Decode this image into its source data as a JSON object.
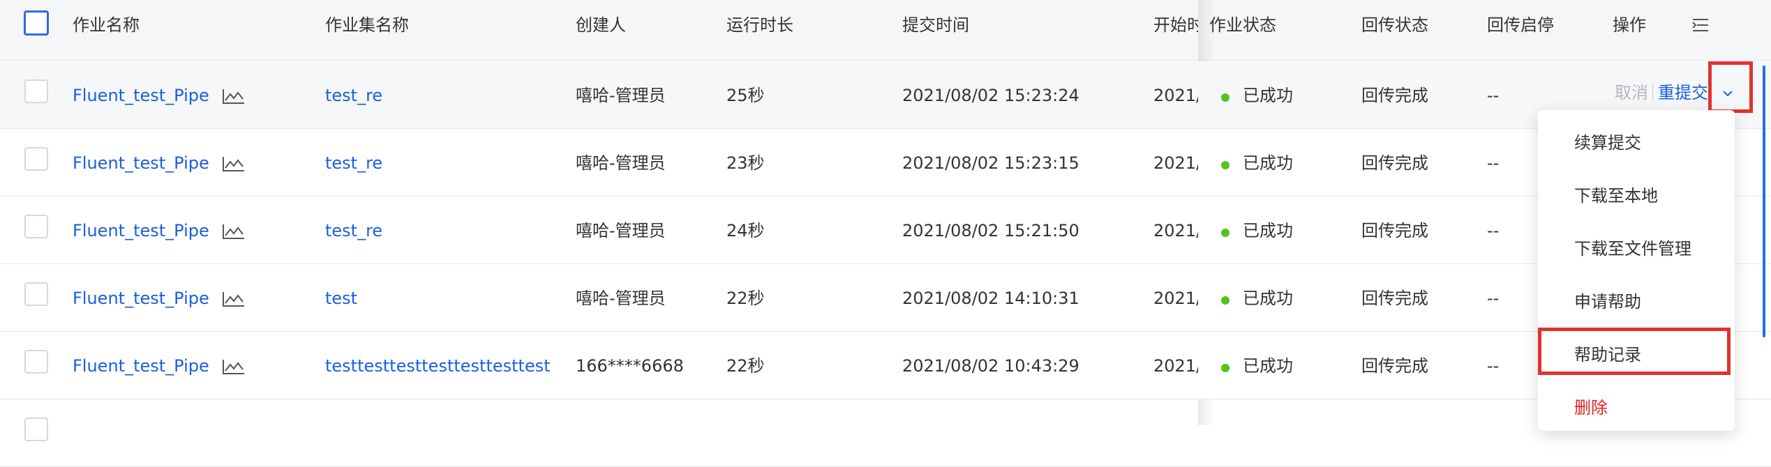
{
  "columns": {
    "job_name": "作业名称",
    "jobset_name": "作业集名称",
    "creator": "创建人",
    "duration": "运行时长",
    "submit_time": "提交时间",
    "start_time": "开始时间",
    "job_status": "作业状态",
    "return_status": "回传状态",
    "return_toggle": "回传启停",
    "operation": "操作"
  },
  "rows": [
    {
      "job_name": "Fluent_test_Pipe",
      "jobset_name": "test_re",
      "creator": "嘻哈-管理员",
      "duration": "25秒",
      "submit_time": "2021/08/02 15:23:24",
      "start_time": "2021/",
      "job_status": "已成功",
      "return_status": "回传完成",
      "return_toggle": "--"
    },
    {
      "job_name": "Fluent_test_Pipe",
      "jobset_name": "test_re",
      "creator": "嘻哈-管理员",
      "duration": "23秒",
      "submit_time": "2021/08/02 15:23:15",
      "start_time": "2021/",
      "job_status": "已成功",
      "return_status": "回传完成",
      "return_toggle": "--"
    },
    {
      "job_name": "Fluent_test_Pipe",
      "jobset_name": "test_re",
      "creator": "嘻哈-管理员",
      "duration": "24秒",
      "submit_time": "2021/08/02 15:21:50",
      "start_time": "2021/",
      "job_status": "已成功",
      "return_status": "回传完成",
      "return_toggle": "--"
    },
    {
      "job_name": "Fluent_test_Pipe",
      "jobset_name": "test",
      "creator": "嘻哈-管理员",
      "duration": "22秒",
      "submit_time": "2021/08/02 14:10:31",
      "start_time": "2021/",
      "job_status": "已成功",
      "return_status": "回传完成",
      "return_toggle": "--"
    },
    {
      "job_name": "Fluent_test_Pipe",
      "jobset_name": "testtesttesttesttesttesttest",
      "creator": "166****6668",
      "duration": "22秒",
      "submit_time": "2021/08/02 10:43:29",
      "start_time": "2021/",
      "job_status": "已成功",
      "return_status": "回传完成",
      "return_toggle": "--"
    }
  ],
  "row_actions": {
    "cancel": "取消",
    "resubmit": "重提交"
  },
  "dropdown_menu": [
    "续算提交",
    "下载至本地",
    "下载至文件管理",
    "申请帮助",
    "帮助记录",
    "删除"
  ],
  "icons": {
    "trend": "line-chart-icon",
    "column_settings": "list-settings-icon",
    "more": "chevron-down-icon"
  },
  "colors": {
    "link": "#1a5fe0",
    "success": "#52c41a",
    "danger": "#e02020",
    "highlight_box": "#e0322f"
  }
}
